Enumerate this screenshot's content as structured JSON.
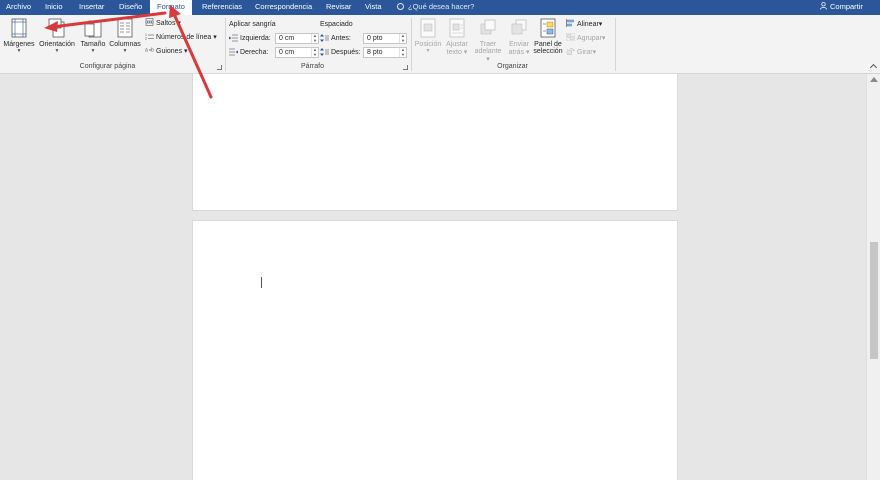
{
  "tabs": [
    "Archivo",
    "Inicio",
    "Insertar",
    "Diseño",
    "Formato",
    "Referencias",
    "Correspondencia",
    "Revisar",
    "Vista"
  ],
  "active_tab": "Formato",
  "tell_me": "¿Qué desea hacer?",
  "share": "Compartir",
  "ribbon": {
    "page_setup": {
      "margins": "Márgenes",
      "orientation": "Orientación",
      "size": "Tamaño",
      "columns": "Columnas",
      "breaks": "Saltos",
      "line_numbers": "Números de línea",
      "hyphenation": "Guiones",
      "group_label": "Configurar página"
    },
    "paragraph": {
      "indent_title": "Aplicar sangría",
      "left_label": "Izquierda:",
      "left_value": "0 cm",
      "right_label": "Derecha:",
      "right_value": "0 cm",
      "spacing_title": "Espaciado",
      "before_label": "Antes:",
      "before_value": "0 pto",
      "after_label": "Después:",
      "after_value": "8 pto",
      "group_label": "Párrafo"
    },
    "arrange": {
      "position": "Posición",
      "wrap_1": "Ajustar",
      "wrap_2": "texto",
      "forward_1": "Traer",
      "forward_2": "adelante",
      "backward_1": "Enviar",
      "backward_2": "atrás",
      "pane_1": "Panel de",
      "pane_2": "selección",
      "align": "Alinear",
      "group": "Agrupar",
      "rotate": "Girar",
      "group_label": "Organizar"
    }
  },
  "colors": {
    "title_bar": "#2b579a",
    "ribbon_bg": "#f3f3f3",
    "doc_bg": "#e6e6e6",
    "annotation_arrow": "#d9383c"
  }
}
